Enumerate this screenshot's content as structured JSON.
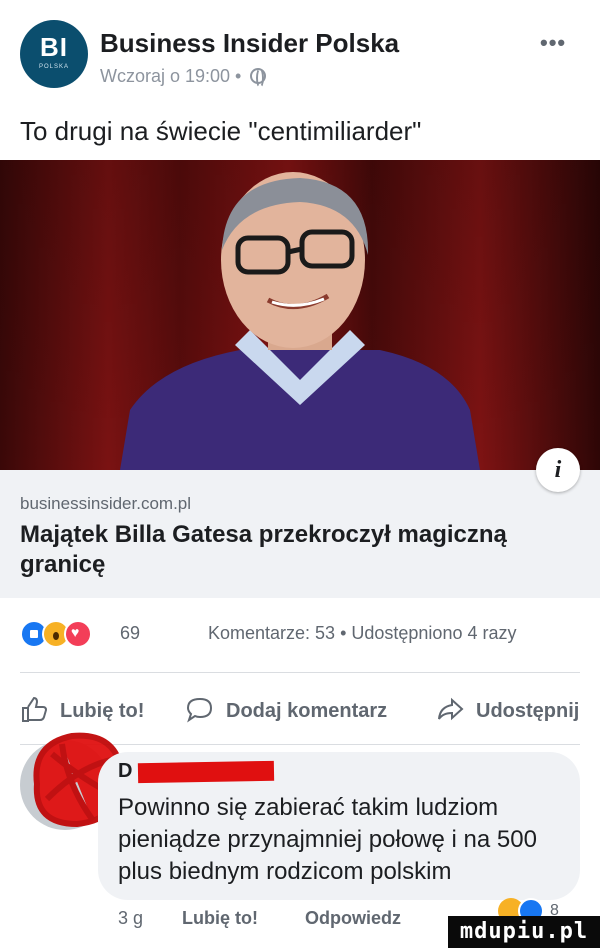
{
  "post": {
    "page_name": "Business Insider Polska",
    "avatar_text": "BI",
    "avatar_subtext": "POLSKA",
    "timestamp": "Wczoraj o 19:00 •",
    "more_label": "•••",
    "text": "To drugi na świecie \"centimiliarder\""
  },
  "link_card": {
    "domain": "businessinsider.com.pl",
    "title": "Majątek Billa Gatesa przekroczył magiczną granicę",
    "info_label": "i"
  },
  "engagement": {
    "reaction_count": "69",
    "stats": "Komentarze: 53 • Udostępniono 4 razy"
  },
  "actions": {
    "like": "Lubię to!",
    "comment": "Dodaj komentarz",
    "share": "Udostępnij"
  },
  "comment": {
    "author": "D",
    "text": "Powinno się zabierać takim ludziom pieniądze przynajmniej połowę i na 500 plus biednym rodzicom polskim",
    "time": "3 g",
    "like": "Lubię to!",
    "reply": "Odpowiedz",
    "reaction_count": "8"
  },
  "watermark": "mdupiu.pl",
  "colors": {
    "facebook_blue": "#1877f2",
    "avatar_bg": "#0b4e6e",
    "redaction": "#e01010",
    "card_bg": "#f0f2f5"
  },
  "icons": [
    "globe-icon",
    "more-icon",
    "info-icon",
    "like-reaction-icon",
    "wow-reaction-icon",
    "love-reaction-icon",
    "thumbs-up-icon",
    "comment-icon",
    "share-icon"
  ]
}
